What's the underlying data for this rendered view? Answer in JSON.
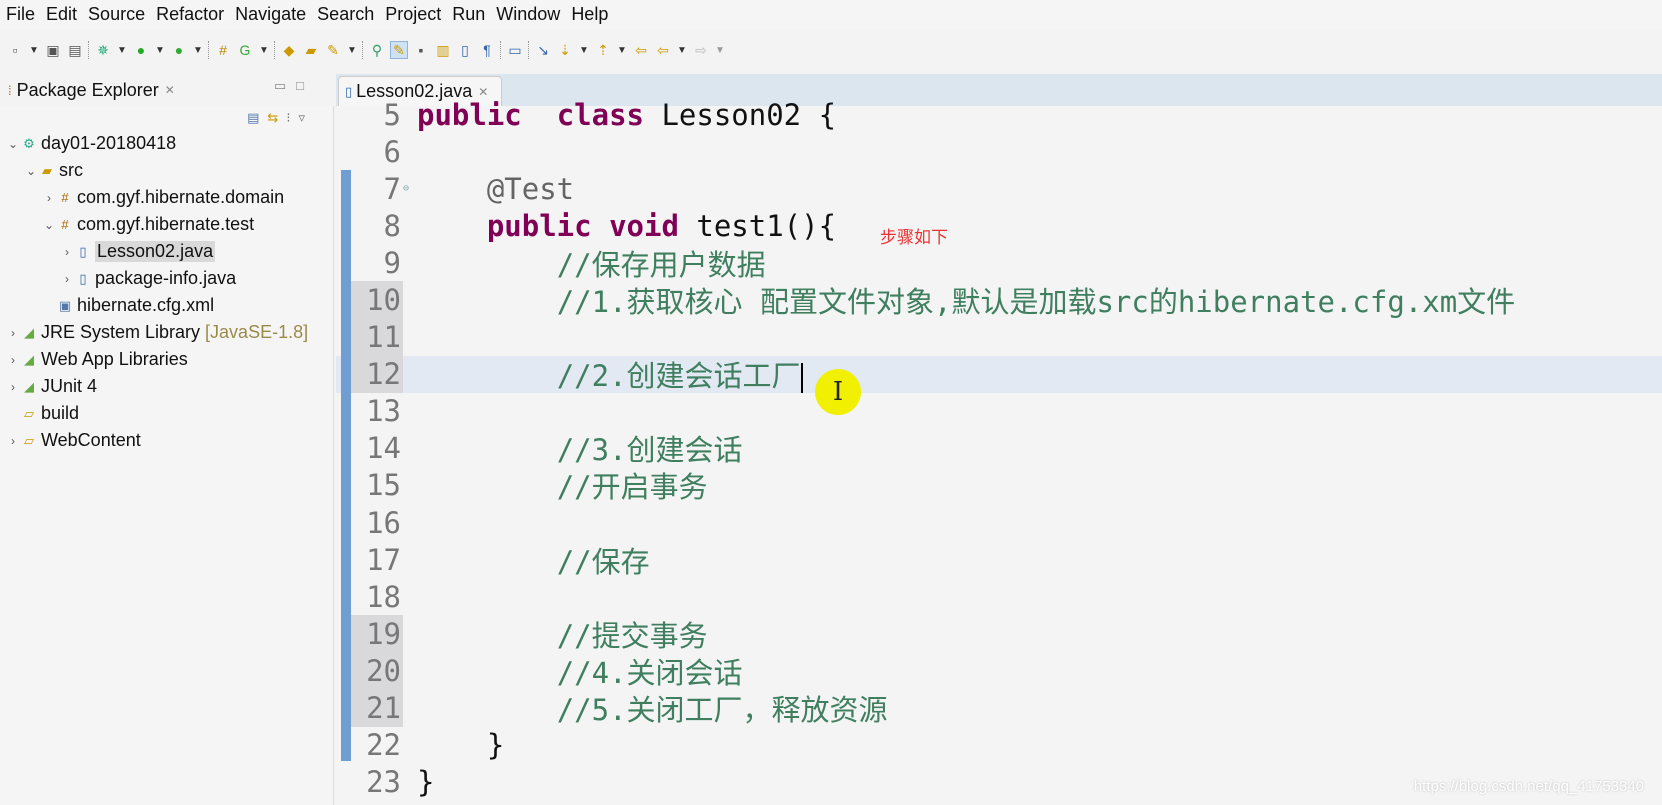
{
  "menu": [
    "File",
    "Edit",
    "Source",
    "Refactor",
    "Navigate",
    "Search",
    "Project",
    "Run",
    "Window",
    "Help"
  ],
  "package_explorer": {
    "title": "Package Explorer",
    "tree": [
      {
        "label": "day01-20180418",
        "depth": 0,
        "twisty": "open",
        "icon": "project-icon"
      },
      {
        "label": "src",
        "depth": 1,
        "twisty": "open",
        "icon": "source-folder-icon"
      },
      {
        "label": "com.gyf.hibernate.domain",
        "depth": 2,
        "twisty": "closed",
        "icon": "package-icon"
      },
      {
        "label": "com.gyf.hibernate.test",
        "depth": 2,
        "twisty": "open",
        "icon": "package-icon"
      },
      {
        "label": "Lesson02.java",
        "depth": 3,
        "twisty": "closed",
        "icon": "java-file-icon",
        "selected": true
      },
      {
        "label": "package-info.java",
        "depth": 3,
        "twisty": "closed",
        "icon": "java-file-icon"
      },
      {
        "label": "hibernate.cfg.xml",
        "depth": 2,
        "twisty": "none",
        "icon": "xml-file-icon"
      },
      {
        "label": "JRE System Library",
        "decoration": "[JavaSE-1.8]",
        "depth": 0,
        "twisty": "closed",
        "icon": "library-icon"
      },
      {
        "label": "Web App Libraries",
        "depth": 0,
        "twisty": "closed",
        "icon": "library-icon"
      },
      {
        "label": "JUnit 4",
        "depth": 0,
        "twisty": "closed",
        "icon": "library-icon"
      },
      {
        "label": "build",
        "depth": 0,
        "twisty": "none",
        "icon": "folder-icon"
      },
      {
        "label": "WebContent",
        "depth": 0,
        "twisty": "closed",
        "icon": "folder-icon"
      }
    ]
  },
  "editor": {
    "tab": "Lesson02.java",
    "current_line": 12,
    "lines": [
      {
        "n": "5",
        "tokens": [
          [
            "kw",
            "public"
          ],
          [
            "",
            "  "
          ],
          [
            "kw",
            "class"
          ],
          [
            "",
            " Lesson02 {"
          ]
        ]
      },
      {
        "n": "6",
        "tokens": []
      },
      {
        "n": "7",
        "tokens": [
          [
            "",
            "    "
          ],
          [
            "an",
            "@Test"
          ]
        ]
      },
      {
        "n": "8",
        "tokens": [
          [
            "",
            "    "
          ],
          [
            "kw",
            "public"
          ],
          [
            "",
            " "
          ],
          [
            "kw",
            "void"
          ],
          [
            "",
            " test1(){"
          ]
        ]
      },
      {
        "n": "9",
        "tokens": [
          [
            "",
            "        "
          ],
          [
            "cm",
            "//保存用户数据"
          ]
        ]
      },
      {
        "n": "10",
        "tokens": [
          [
            "",
            "        "
          ],
          [
            "cm",
            "//1.获取核心 配置文件对象,默认是加载src的hibernate.cfg.xm文件"
          ]
        ]
      },
      {
        "n": "11",
        "tokens": []
      },
      {
        "n": "12",
        "tokens": [
          [
            "",
            "        "
          ],
          [
            "cm",
            "//2.创建会话工厂"
          ]
        ]
      },
      {
        "n": "13",
        "tokens": []
      },
      {
        "n": "14",
        "tokens": [
          [
            "",
            "        "
          ],
          [
            "cm",
            "//3.创建会话"
          ]
        ]
      },
      {
        "n": "15",
        "tokens": [
          [
            "",
            "        "
          ],
          [
            "cm",
            "//开启事务"
          ]
        ]
      },
      {
        "n": "16",
        "tokens": []
      },
      {
        "n": "17",
        "tokens": [
          [
            "",
            "        "
          ],
          [
            "cm",
            "//保存"
          ]
        ]
      },
      {
        "n": "18",
        "tokens": []
      },
      {
        "n": "19",
        "tokens": [
          [
            "",
            "        "
          ],
          [
            "cm",
            "//提交事务"
          ]
        ]
      },
      {
        "n": "20",
        "tokens": [
          [
            "",
            "        "
          ],
          [
            "cm",
            "//4.关闭会话"
          ]
        ]
      },
      {
        "n": "21",
        "tokens": [
          [
            "",
            "        "
          ],
          [
            "cm",
            "//5.关闭工厂，释放资源"
          ]
        ]
      },
      {
        "n": "22",
        "tokens": [
          [
            "",
            "    }"
          ]
        ]
      },
      {
        "n": "23",
        "tokens": [
          [
            "",
            "}"
          ]
        ]
      }
    ]
  },
  "annotation": "步骤如下",
  "watermark": "https://blog.csdn.net/qq_41753340",
  "colors": {
    "keyword": "#7f0055",
    "comment": "#3f7f5f",
    "annotation_note": "#e33333",
    "cursor_highlight": "#f0f000"
  }
}
